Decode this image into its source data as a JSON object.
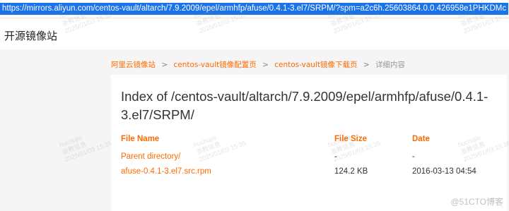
{
  "browser": {
    "url": "https://mirrors.aliyun.com/centos-vault/altarch/7.9.2009/epel/armhfp/afuse/0.4.1-3.el7/SRPM/?spm=a2c6h.25603864.0.0.426958e1PHKDMc"
  },
  "site": {
    "title": "开源镜像站"
  },
  "breadcrumb": {
    "items": [
      "阿里云镜像站",
      "centos-vault镜像配置页",
      "centos-vault镜像下载页"
    ],
    "current": "详细内容",
    "separator": ">"
  },
  "listing": {
    "heading": "Index of /centos-vault/altarch/7.9.2009/epel/armhfp/afuse/0.4.1-3.el7/SRPM/",
    "columns": {
      "name": "File Name",
      "size": "File Size",
      "date": "Date"
    },
    "rows": [
      {
        "name": "Parent directory/",
        "size": "-",
        "date": "-"
      },
      {
        "name": "afuse-0.4.1-3.el7.src.rpm",
        "size": "124.2 KB",
        "date": "2016-03-13 04:54"
      }
    ]
  },
  "watermark": {
    "user": "huchujie",
    "org": "浙教信息",
    "time": "2025/01/03 15:35"
  },
  "footer": {
    "credit": "@51CTO博客"
  }
}
